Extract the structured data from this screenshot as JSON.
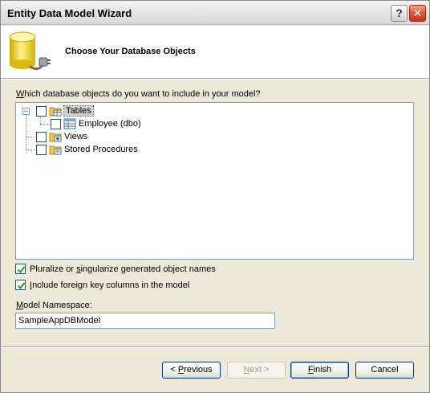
{
  "window": {
    "title": "Entity Data Model Wizard",
    "help_label": "?",
    "close_label": "✕"
  },
  "header": {
    "title": "Choose Your Database Objects",
    "icon": "database-icon"
  },
  "prompt": {
    "underlined": "W",
    "rest": "hich database objects do you want to include in your model?"
  },
  "tree": {
    "nodes": [
      {
        "label": "Tables",
        "checked": false,
        "expanded": true,
        "selected": true,
        "icon": "tables-folder-icon"
      },
      {
        "label": "Employee (dbo)",
        "checked": false,
        "icon": "table-icon"
      },
      {
        "label": "Views",
        "checked": false,
        "icon": "views-folder-icon"
      },
      {
        "label": "Stored Procedures",
        "checked": false,
        "icon": "procedures-folder-icon"
      }
    ]
  },
  "options": {
    "pluralize": {
      "pre": "Pluralize or ",
      "underlined": "s",
      "post": "ingularize generated object names",
      "checked": true
    },
    "foreign_keys": {
      "underlined": "I",
      "post": "nclude foreign key columns in the model",
      "checked": true
    }
  },
  "namespace": {
    "label_underlined": "M",
    "label_rest": "odel Namespace:",
    "value": "SampleAppDBModel"
  },
  "buttons": {
    "previous": {
      "pre": "< ",
      "underlined": "P",
      "post": "revious"
    },
    "next": {
      "pre": "",
      "underlined": "N",
      "post": "ext >",
      "disabled": true
    },
    "finish": {
      "pre": "",
      "underlined": "F",
      "post": "inish"
    },
    "cancel": "Cancel"
  }
}
